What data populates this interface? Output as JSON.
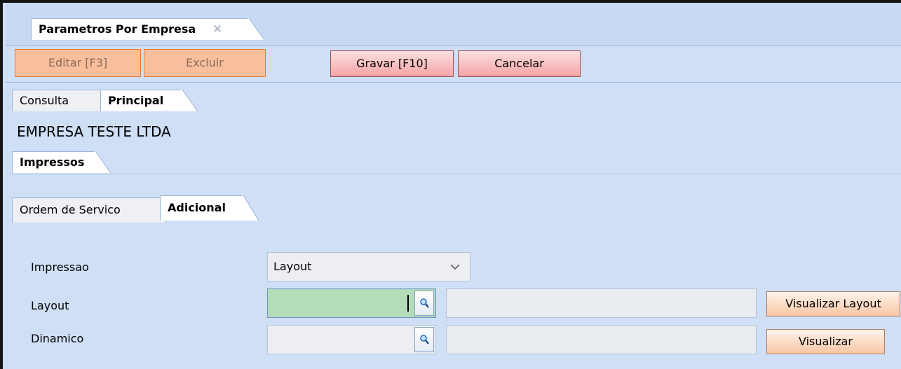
{
  "window_tab": {
    "label": "Parametros Por Empresa",
    "close_glyph": "✕"
  },
  "toolbar": {
    "edit_label": "Editar [F3]",
    "delete_label": "Excluir",
    "save_label": "Gravar [F10]",
    "cancel_label": "Cancelar"
  },
  "view_tabs": [
    {
      "label": "Consulta"
    },
    {
      "label": "Principal"
    }
  ],
  "company_name": "EMPRESA TESTE LTDA",
  "section_tab": {
    "label": "Impressos"
  },
  "sub_tabs": [
    {
      "label": "Ordem de Servico"
    },
    {
      "label": "Adicional"
    }
  ],
  "form": {
    "impressao": {
      "label": "Impressao",
      "value": "Layout"
    },
    "layout": {
      "label": "Layout",
      "value": "",
      "description": "",
      "button": "Visualizar Layout"
    },
    "dinamico": {
      "label": "Dinamico",
      "value": "",
      "description": "",
      "button": "Visualizar"
    }
  },
  "colors": {
    "background": "#cfdff5",
    "active_field": "#b3dcb9",
    "disabled_button": "#f9bf9c",
    "action_button": "#f6a4a6"
  },
  "icons": {
    "lookup": "magnifier-icon",
    "dropdown": "chevron-down-icon"
  }
}
